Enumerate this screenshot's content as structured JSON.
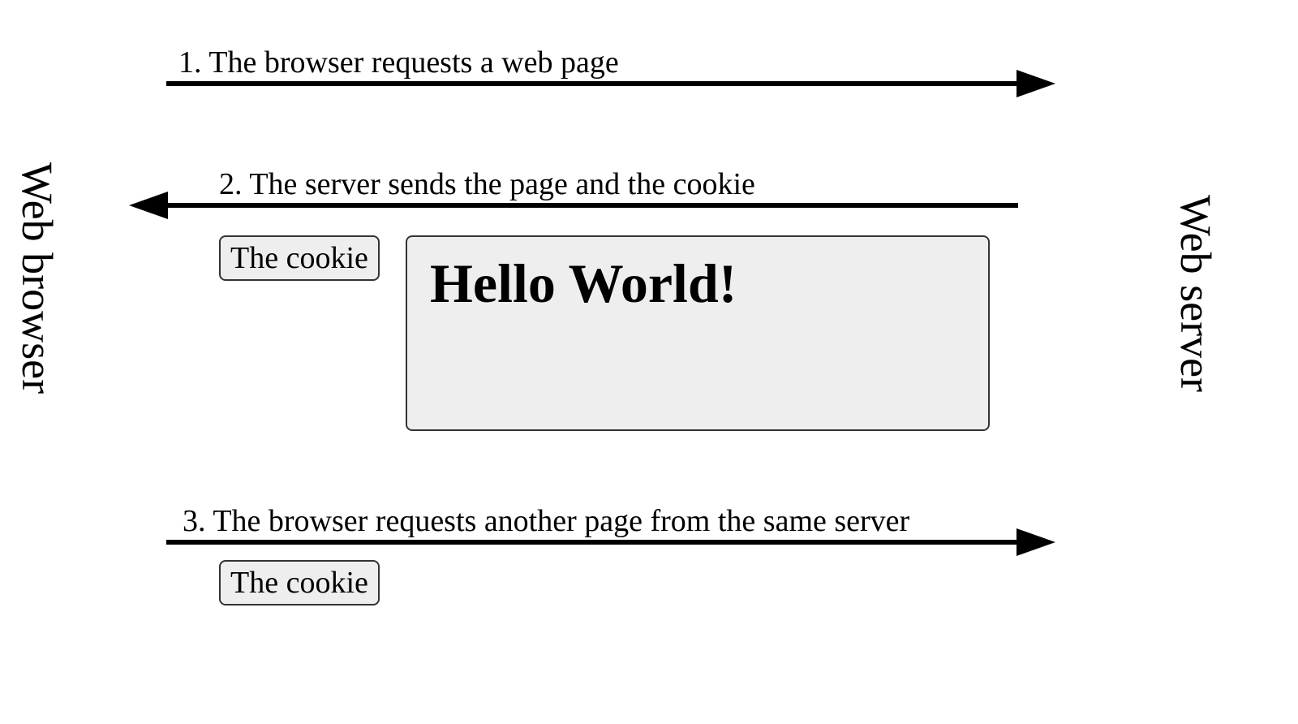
{
  "actors": {
    "left": "Web browser",
    "right": "Web server"
  },
  "steps": {
    "s1": "1. The browser requests a web page",
    "s2": "2. The server sends the page and the cookie",
    "s3": "3. The browser requests another page from the same server"
  },
  "payload": {
    "cookie_label": "The cookie",
    "page_content": "Hello World!"
  }
}
